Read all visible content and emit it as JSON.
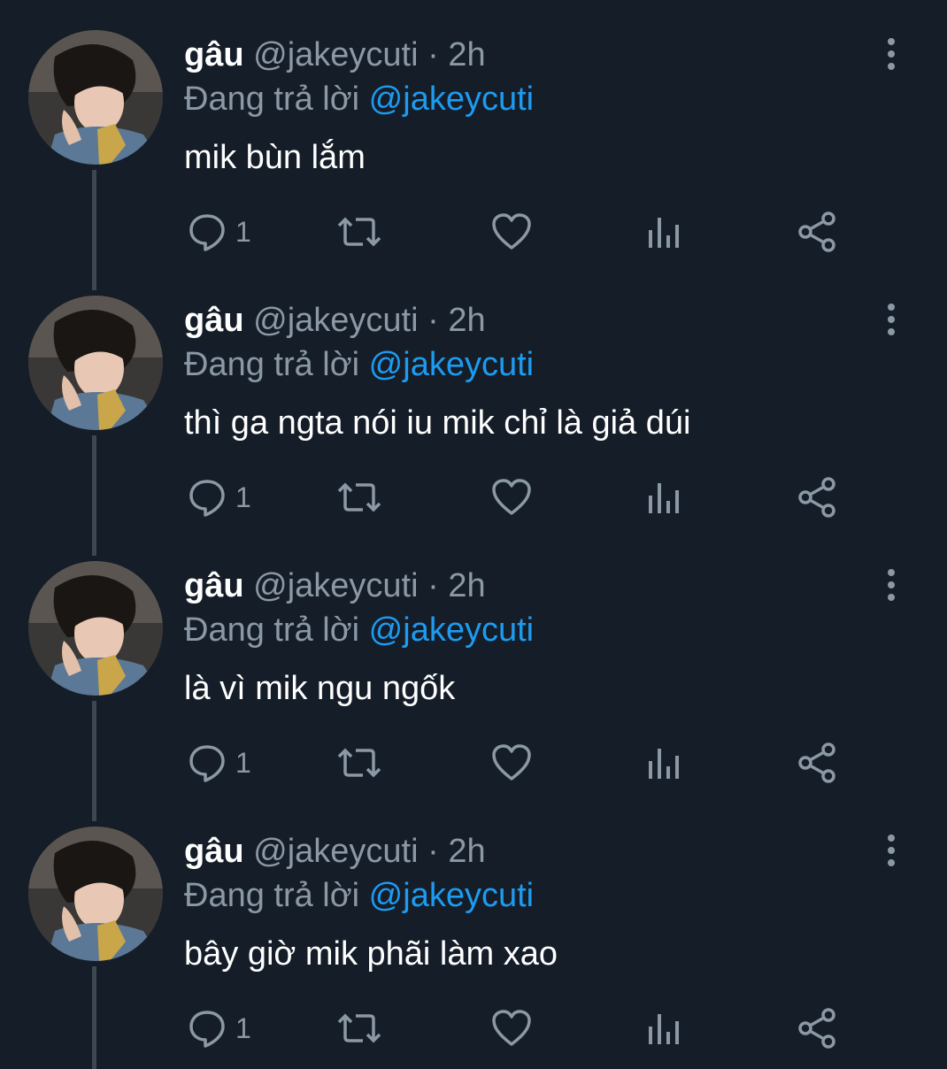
{
  "colors": {
    "background": "#151d28",
    "secondary_text": "#8b98a5",
    "link": "#1d9bf0",
    "primary_text": "#ffffff"
  },
  "tweets": [
    {
      "name": "gâu",
      "handle": "@jakeycuti",
      "separator": "·",
      "time": "2h",
      "reply_prefix": "Đang trả lời",
      "reply_handle": "@jakeycuti",
      "text": "mik bùn lắm",
      "reply_count": "1"
    },
    {
      "name": "gâu",
      "handle": "@jakeycuti",
      "separator": "·",
      "time": "2h",
      "reply_prefix": "Đang trả lời",
      "reply_handle": "@jakeycuti",
      "text": "thì ga ngta nói iu mik chỉ là giả dúi",
      "reply_count": "1"
    },
    {
      "name": "gâu",
      "handle": "@jakeycuti",
      "separator": "·",
      "time": "2h",
      "reply_prefix": "Đang trả lời",
      "reply_handle": "@jakeycuti",
      "text": "là vì mik ngu ngốk",
      "reply_count": "1"
    },
    {
      "name": "gâu",
      "handle": "@jakeycuti",
      "separator": "·",
      "time": "2h",
      "reply_prefix": "Đang trả lời",
      "reply_handle": "@jakeycuti",
      "text": "bây giờ mik phãi làm xao",
      "reply_count": "1"
    }
  ],
  "icons": {
    "reply": "reply-icon",
    "retweet": "retweet-icon",
    "like": "heart-icon",
    "views": "views-icon",
    "share": "share-icon",
    "more": "more-vertical-icon"
  }
}
